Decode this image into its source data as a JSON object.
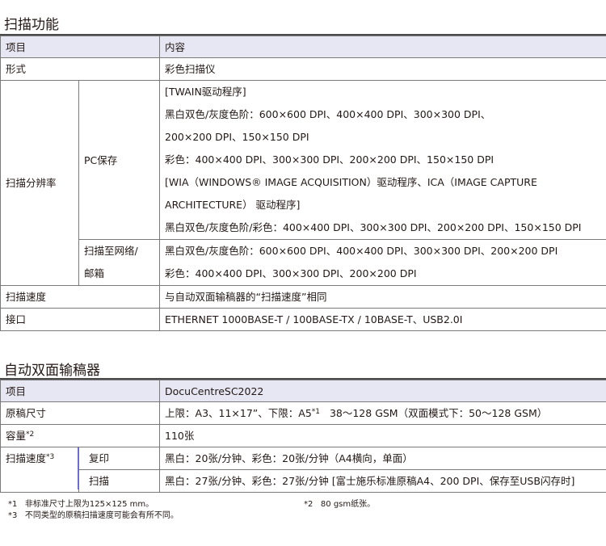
{
  "scan": {
    "title": "扫描功能",
    "head": [
      "项目",
      "内容"
    ],
    "form": {
      "label": "形式",
      "value": "彩色扫描仪"
    },
    "resolution": {
      "label": "扫描分辨率",
      "pc": {
        "label": "PC保存",
        "lines": [
          "[TWAIN驱动程序]",
          "黑白双色/灰度色阶：600×600 DPI、400×400 DPI、300×300 DPI、",
          "200×200 DPI、150×150 DPI",
          "彩色：400×400 DPI、300×300 DPI、200×200 DPI、150×150 DPI",
          "[WIA（WINDOWS® IMAGE ACQUISITION）驱动程序、ICA（IMAGE CAPTURE",
          "ARCHITECTURE） 驱动程序]",
          "黑白双色/灰度色阶/彩色：400×400 DPI、300×300 DPI、200×200 DPI、150×150 DPI"
        ]
      },
      "network": {
        "label_line1": "扫描至网络/",
        "label_line2": "邮箱",
        "lines": [
          "黑白双色/灰度色阶：600×600 DPI、400×400 DPI、300×300 DPI、200×200 DPI",
          "彩色：400×400 DPI、300×300 DPI、200×200 DPI"
        ]
      }
    },
    "speed": {
      "label": "扫描速度",
      "value": "与自动双面输稿器的“扫描速度”相同"
    },
    "interface": {
      "label": "接口",
      "value": "ETHERNET 1000BASE-T / 100BASE-TX / 10BASE-T、USB2.0I"
    }
  },
  "adf": {
    "title": "自动双面输稿器",
    "head": [
      "项目",
      "DocuCentreSC2022"
    ],
    "size": {
      "label": "原稿尺寸",
      "value_a": "上限：A3、11×17”、下限：A5",
      "note_a": "*1",
      "value_b": "38～128 GSM（双面模式下：50～128 GSM）"
    },
    "capacity": {
      "label": "容量",
      "note": "*2",
      "value": "110张"
    },
    "speed": {
      "label": "扫描速度",
      "note": "*3",
      "copy": {
        "label": "复印",
        "value": "黑白：20张/分钟、彩色：20张/分钟（A4横向，单面）"
      },
      "scan": {
        "label": "扫描",
        "value": "黑白：27张/分钟、彩色：27张/分钟 [富士施乐标准原稿A4、200 DPI、保存至USB闪存时]"
      }
    }
  },
  "footnotes": {
    "n1_mark": "*1",
    "n1": "非标准尺寸上限为125×125 mm。",
    "n2_mark": "*2",
    "n2": "80 gsm纸张。",
    "n3_mark": "*3",
    "n3": "不同类型的原稿扫描速度可能会有所不同。"
  }
}
